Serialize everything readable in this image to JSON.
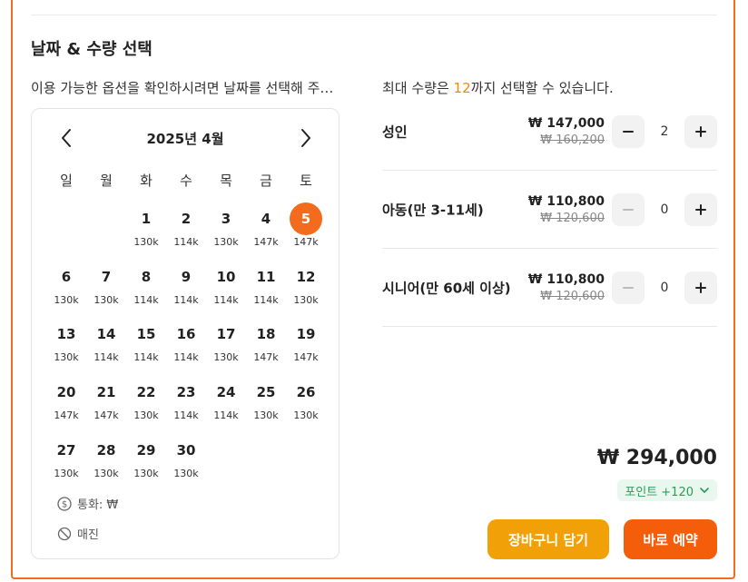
{
  "section": {
    "title": "날짜 & 수량 선택"
  },
  "hints": {
    "left": "이용 가능한 옵션을 확인하시려면 날짜를 선택해 주세요",
    "right_prefix": "최대 수량은 ",
    "right_max": "12",
    "right_suffix": "까지 선택할 수 있습니다."
  },
  "calendar": {
    "month_label": "2025년 4월",
    "prev_icon": "chevron-left-icon",
    "next_icon": "chevron-right-icon",
    "weekdays": [
      "일",
      "월",
      "화",
      "수",
      "목",
      "금",
      "토"
    ],
    "leading_blanks": 2,
    "selected_day": "5",
    "days": [
      {
        "day": "1",
        "price": "130k"
      },
      {
        "day": "2",
        "price": "114k"
      },
      {
        "day": "3",
        "price": "130k"
      },
      {
        "day": "4",
        "price": "147k"
      },
      {
        "day": "5",
        "price": "147k"
      },
      {
        "day": "6",
        "price": "130k"
      },
      {
        "day": "7",
        "price": "130k"
      },
      {
        "day": "8",
        "price": "114k"
      },
      {
        "day": "9",
        "price": "114k"
      },
      {
        "day": "10",
        "price": "114k"
      },
      {
        "day": "11",
        "price": "114k"
      },
      {
        "day": "12",
        "price": "130k"
      },
      {
        "day": "13",
        "price": "130k"
      },
      {
        "day": "14",
        "price": "114k"
      },
      {
        "day": "15",
        "price": "114k"
      },
      {
        "day": "16",
        "price": "114k"
      },
      {
        "day": "17",
        "price": "130k"
      },
      {
        "day": "18",
        "price": "147k"
      },
      {
        "day": "19",
        "price": "147k"
      },
      {
        "day": "20",
        "price": "147k"
      },
      {
        "day": "21",
        "price": "147k"
      },
      {
        "day": "22",
        "price": "130k"
      },
      {
        "day": "23",
        "price": "114k"
      },
      {
        "day": "24",
        "price": "114k"
      },
      {
        "day": "25",
        "price": "130k"
      },
      {
        "day": "26",
        "price": "130k"
      },
      {
        "day": "27",
        "price": "130k"
      },
      {
        "day": "28",
        "price": "130k"
      },
      {
        "day": "29",
        "price": "130k"
      },
      {
        "day": "30",
        "price": "130k"
      }
    ],
    "legend_currency": "통화: ₩",
    "legend_soldout": "매진"
  },
  "quantities": [
    {
      "label": "성인",
      "price": "₩ 147,000",
      "original": "₩ 160,200",
      "value": "2",
      "minus_enabled": true
    },
    {
      "label": "아동(만 3-11세)",
      "price": "₩ 110,800",
      "original": "₩ 120,600",
      "value": "0",
      "minus_enabled": false
    },
    {
      "label": "시니어(만 60세 이상)",
      "price": "₩ 110,800",
      "original": "₩ 120,600",
      "value": "0",
      "minus_enabled": false
    }
  ],
  "summary": {
    "total": "₩ 294,000",
    "points": "포인트 +120"
  },
  "buttons": {
    "cart": "장바구니 담기",
    "book": "바로 예약"
  },
  "colors": {
    "accent": "#f36b1c",
    "cart_button": "#f2a007",
    "book_button": "#f45d09",
    "points_text": "#2a9d58",
    "max_highlight": "#f08a00"
  }
}
